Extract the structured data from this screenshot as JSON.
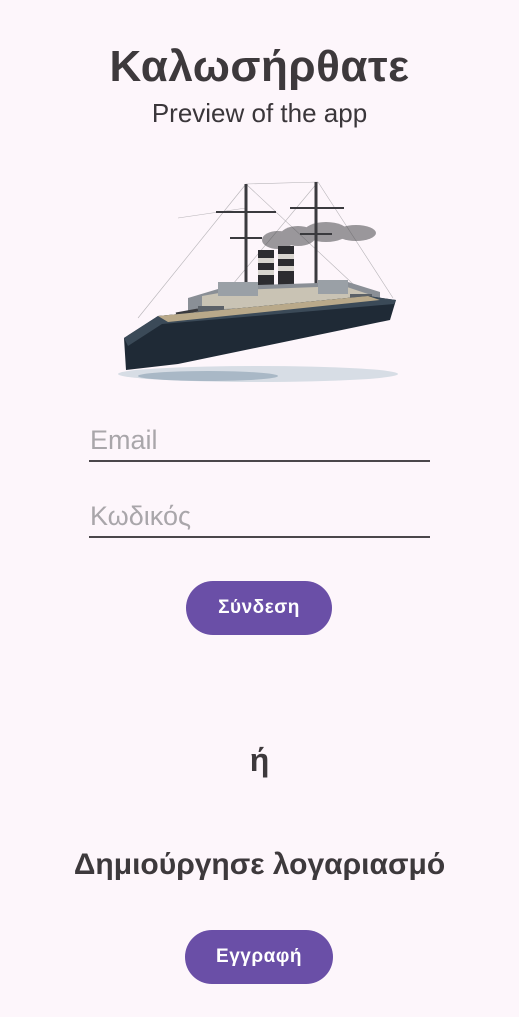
{
  "header": {
    "title": "Καλωσήρθατε",
    "subtitle": "Preview of the app"
  },
  "login_form": {
    "email_placeholder": "Email",
    "password_placeholder": "Κωδικός",
    "login_label": "Σύνδεση"
  },
  "divider_text": "ή",
  "signup": {
    "prompt": "Δημιούργησε λογαριασμό",
    "button_label": "Εγγραφή"
  },
  "colors": {
    "background": "#fdf6fb",
    "primary": "#6a4fa7",
    "text": "#3d393c"
  }
}
